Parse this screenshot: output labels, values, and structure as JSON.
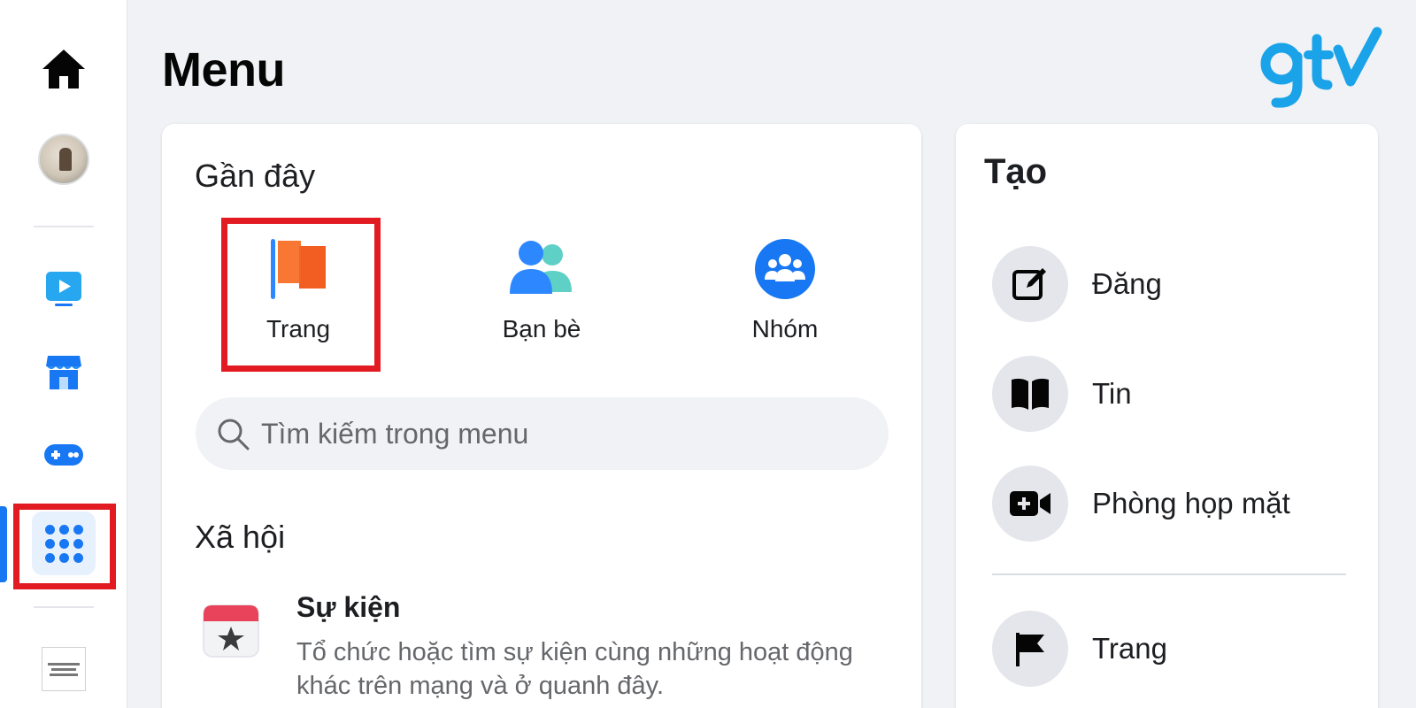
{
  "header": {
    "title": "Menu"
  },
  "sidebar": {
    "items": [
      {
        "name": "home",
        "icon": "home-icon"
      },
      {
        "name": "profile",
        "icon": "avatar"
      },
      {
        "name": "watch",
        "icon": "video-icon"
      },
      {
        "name": "marketplace",
        "icon": "store-icon"
      },
      {
        "name": "gaming",
        "icon": "gamepad-icon"
      },
      {
        "name": "menu",
        "icon": "grid-icon",
        "active": true
      },
      {
        "name": "shortcut",
        "icon": "page-thumbnail"
      }
    ]
  },
  "recent": {
    "title": "Gần đây",
    "items": [
      {
        "label": "Trang",
        "icon": "flag-icon"
      },
      {
        "label": "Bạn bè",
        "icon": "friends-icon"
      },
      {
        "label": "Nhóm",
        "icon": "groups-icon"
      }
    ]
  },
  "search": {
    "placeholder": "Tìm kiếm trong menu"
  },
  "social": {
    "title": "Xã hội",
    "items": [
      {
        "title": "Sự kiện",
        "description": "Tổ chức hoặc tìm sự kiện cùng những hoạt động khác trên mạng và ở quanh đây.",
        "icon": "calendar-icon"
      }
    ]
  },
  "create": {
    "title": "Tạo",
    "items": [
      {
        "label": "Đăng",
        "icon": "compose-icon"
      },
      {
        "label": "Tin",
        "icon": "book-icon"
      },
      {
        "label": "Phòng họp mặt",
        "icon": "video-add-icon"
      },
      {
        "label": "Trang",
        "icon": "flag-icon"
      }
    ]
  },
  "colors": {
    "accent": "#1877f2",
    "highlight": "#e21b23",
    "brand": "#1aa3e8"
  }
}
